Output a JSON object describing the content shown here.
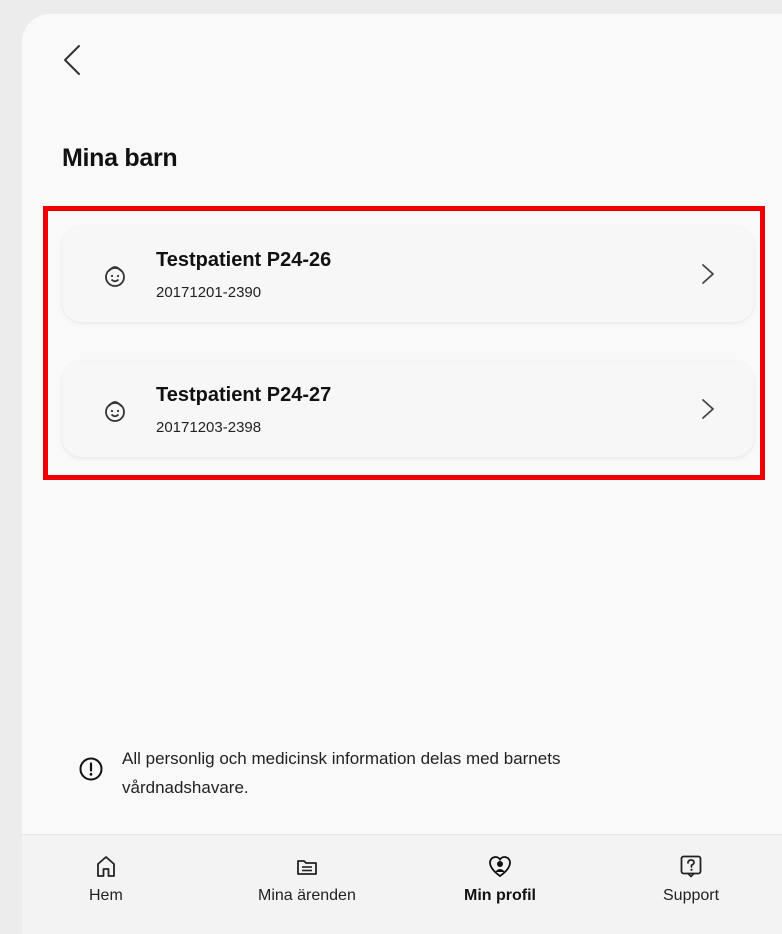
{
  "header": {
    "back_icon": "chevron-left-icon"
  },
  "page": {
    "title": "Mina barn"
  },
  "children": [
    {
      "name": "Testpatient P24-26",
      "personal_number": "20171201-2390",
      "icon": "baby-icon"
    },
    {
      "name": "Testpatient P24-27",
      "personal_number": "20171203-2398",
      "icon": "baby-icon"
    }
  ],
  "info": {
    "icon": "info-circle-icon",
    "text": "All personlig och medicinsk information delas med barnets vårdnadshavare."
  },
  "tabs": [
    {
      "label": "Hem",
      "icon": "home-icon",
      "active": false
    },
    {
      "label": "Mina ärenden",
      "icon": "inbox-icon",
      "active": false
    },
    {
      "label": "Min profil",
      "icon": "profile-heart-icon",
      "active": true
    },
    {
      "label": "Support",
      "icon": "help-box-icon",
      "active": false
    }
  ],
  "colors": {
    "highlight": "#ee0000",
    "background": "#f9f9f9",
    "card": "#f7f7f7"
  }
}
